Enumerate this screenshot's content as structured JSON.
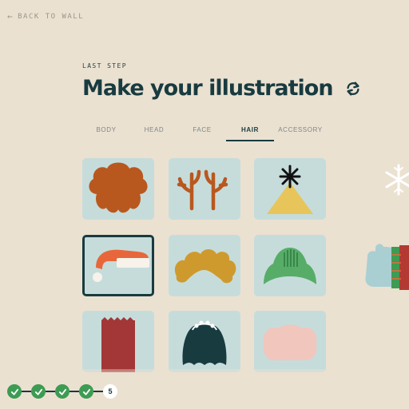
{
  "nav": {
    "back_label": "BACK TO WALL"
  },
  "header": {
    "step_label": "LAST STEP",
    "title": "Make your illustration"
  },
  "tabs": [
    {
      "label": "BODY",
      "active": false
    },
    {
      "label": "HEAD",
      "active": false
    },
    {
      "label": "FACE",
      "active": false
    },
    {
      "label": "HAIR",
      "active": true
    },
    {
      "label": "ACCESSORY",
      "active": false
    }
  ],
  "hair_options": [
    {
      "name": "curly-hair",
      "color": "#b9581e",
      "selected": false
    },
    {
      "name": "antlers",
      "color": "#b9581e",
      "selected": false
    },
    {
      "name": "christmas-tree-star-hat",
      "color": "#e7c55a",
      "selected": false
    },
    {
      "name": "santa-hat",
      "color": "#e8673a",
      "selected": true
    },
    {
      "name": "wavy-blonde-hair",
      "color": "#cf9a2d",
      "selected": false
    },
    {
      "name": "green-beanie",
      "color": "#57ad68",
      "selected": false
    },
    {
      "name": "red-flat-hair",
      "color": "#a33636",
      "selected": false
    },
    {
      "name": "tiara-dark-hair",
      "color": "#183b40",
      "selected": false
    },
    {
      "name": "pink-hair",
      "color": "#f1c6bd",
      "selected": false
    }
  ],
  "progress": {
    "completed_steps": 4,
    "current_step": "5"
  },
  "colors": {
    "background": "#ebe1d1",
    "tile": "#c6dcdb",
    "primary_dark": "#183b40",
    "done_green": "#3e9b53"
  }
}
